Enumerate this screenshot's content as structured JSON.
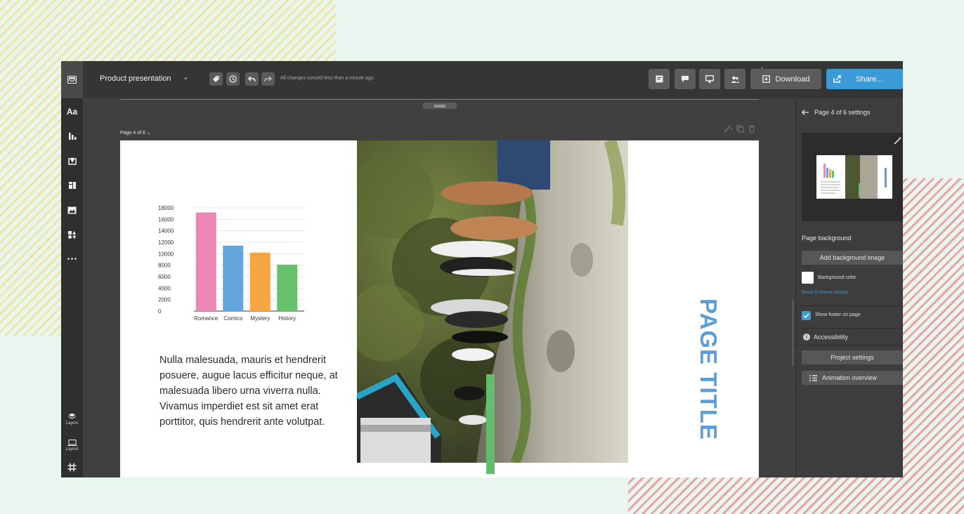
{
  "topbar": {
    "title": "Product presentation",
    "sync_status": "All changes synced less than a minute ago",
    "collab_count": "1",
    "download_label": "Download",
    "share_label": "Share..."
  },
  "rail": {
    "text_label": "Aa",
    "layers_label": "Layers",
    "layout_label": "Layout"
  },
  "canvas": {
    "page_indicator": "Page 4 of 6",
    "paragraph": "Nulla malesuada, mauris et hendrerit posuere, augue lacus efficitur neque, at malesuada libero urna viverra nulla. Vivamus imperdiet est sit amet erat porttitor, quis hendrerit ante volutpat.",
    "page_title": "PAGE TITLE"
  },
  "panel": {
    "heading": "Page 4 of 6 settings",
    "page_background_label": "Page background",
    "add_background_label": "Add background image",
    "background_color_label": "Background color",
    "background_color_value": "#ffffff",
    "reset_label": "Reset to theme default",
    "show_footer_label": "Show footer on page",
    "show_footer_checked": true,
    "accessibility_label": "Accessibility",
    "project_settings_label": "Project settings",
    "animation_overview_label": "Animation overview"
  },
  "colors": {
    "accent": "#3a9bd6",
    "title_blue": "#5b9fd9",
    "green_bar": "#64bd6d"
  },
  "chart_data": {
    "type": "bar",
    "categories": [
      "Romance",
      "Comics",
      "Mystery",
      "History"
    ],
    "values": [
      17200,
      11400,
      10200,
      8100
    ],
    "colors": [
      "#ec87b5",
      "#62a7db",
      "#f6a543",
      "#68c06d"
    ],
    "yticks": [
      "0",
      "2000",
      "4000",
      "6000",
      "8000",
      "10000",
      "12000",
      "14000",
      "16000",
      "18000"
    ],
    "ylim": [
      0,
      18000
    ],
    "grid": true
  }
}
